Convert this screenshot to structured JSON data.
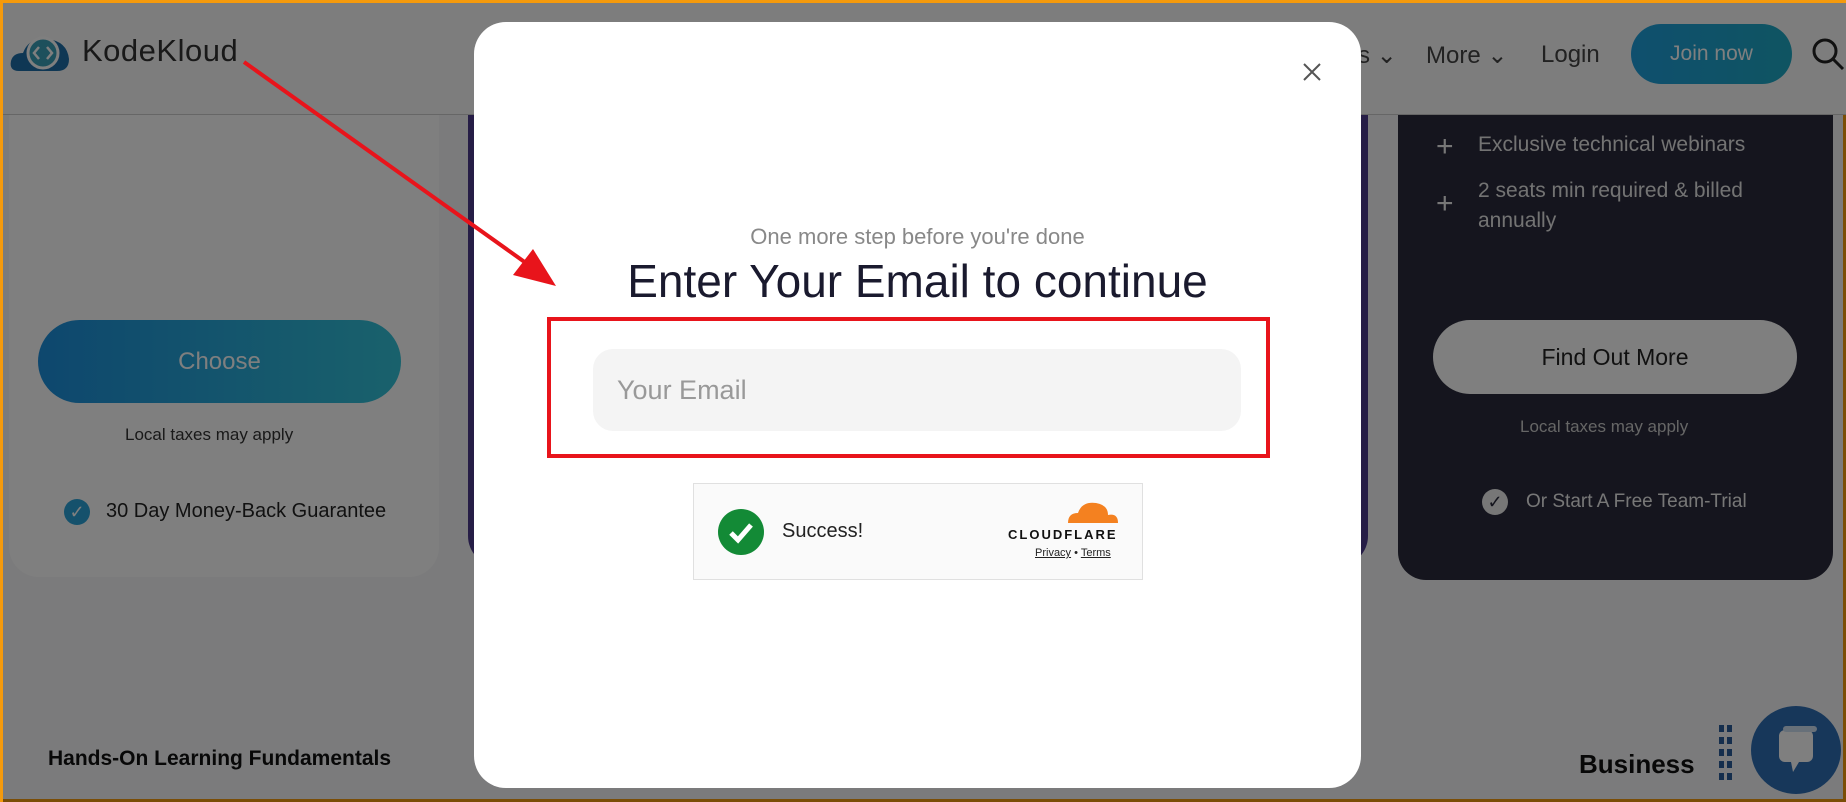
{
  "header": {
    "logo_text": "KodeKloud",
    "nav_partial": "s",
    "nav_more": "More",
    "login": "Login",
    "join": "Join now"
  },
  "left_card": {
    "choose": "Choose",
    "taxes": "Local taxes may apply",
    "guarantee": "30 Day Money-Back Guarantee"
  },
  "right_card": {
    "features": [
      "Exclusive technical webinars",
      "2 seats min required & billed annually"
    ],
    "find_out": "Find Out More",
    "taxes": "Local taxes may apply",
    "trial": "Or Start A Free Team-Trial"
  },
  "bottom": {
    "left_heading": "Hands-On Learning Fundamentals",
    "right_heading": "Business"
  },
  "modal": {
    "subtitle": "One more step before you're done",
    "title": "Enter Your Email to continue",
    "email_placeholder": "Your Email",
    "email_value": "",
    "turnstile": {
      "status": "Success!",
      "brand": "CLOUDFLARE",
      "privacy": "Privacy",
      "separator": "•",
      "terms": "Terms"
    }
  },
  "colors": {
    "accent": "#1f9fdc",
    "annotation": "#e8141b",
    "success": "#138a36",
    "cloudflare": "#f48120",
    "border": "#f59a0c"
  }
}
